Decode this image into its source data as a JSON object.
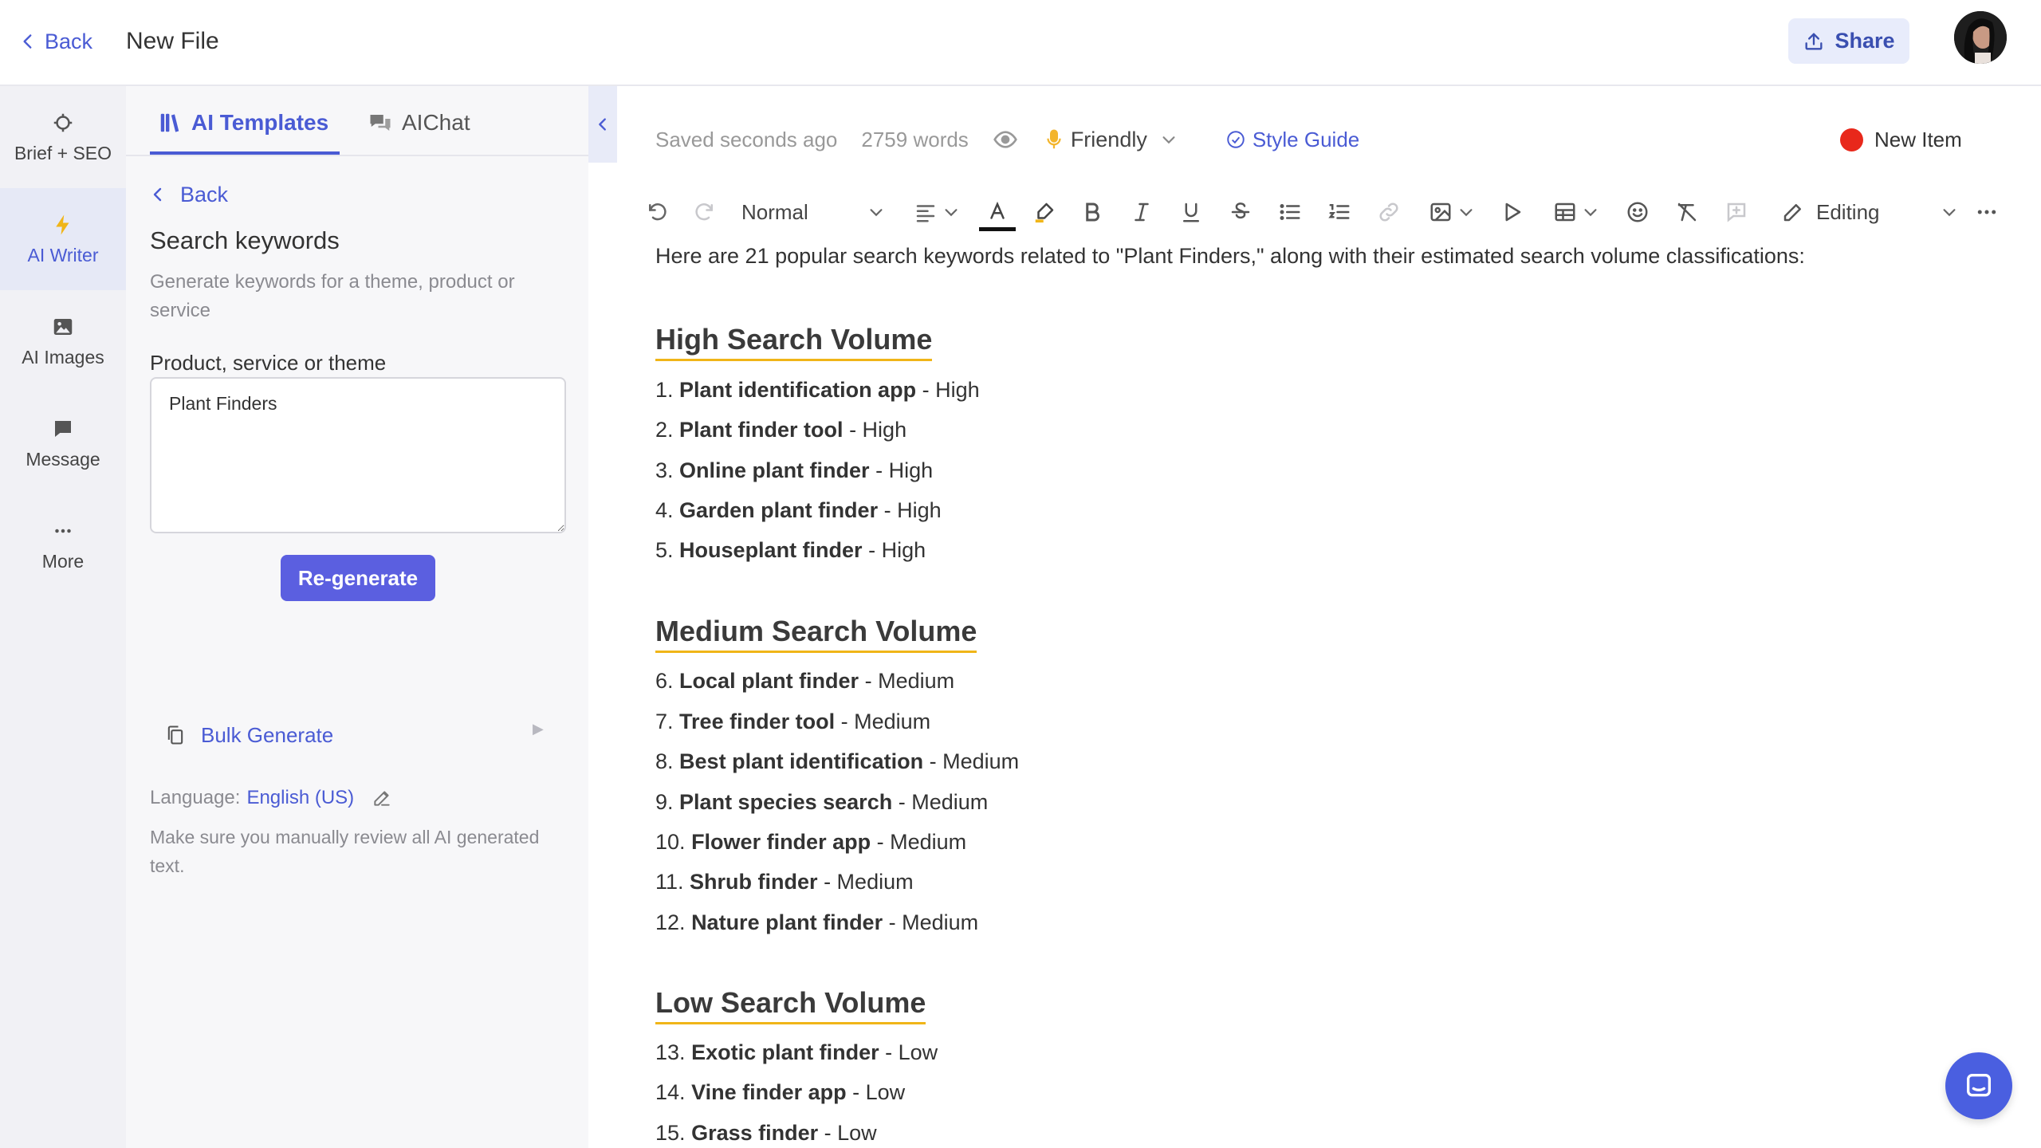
{
  "header": {
    "back_label": "Back",
    "title": "New File",
    "share_label": "Share"
  },
  "rail": {
    "items": [
      {
        "label": "Brief + SEO",
        "icon": "target-icon"
      },
      {
        "label": "AI Writer",
        "icon": "lightning-icon"
      },
      {
        "label": "AI Images",
        "icon": "image-icon"
      },
      {
        "label": "Message",
        "icon": "chat-bubble-icon"
      },
      {
        "label": "More",
        "icon": "more-dots-icon"
      }
    ],
    "active": "AI Writer"
  },
  "panel": {
    "tabs": [
      {
        "label": "AI Templates",
        "icon": "books-icon"
      },
      {
        "label": "AIChat",
        "icon": "chat-bubbles-icon"
      }
    ],
    "back_label": "Back",
    "heading": "Search keywords",
    "description": "Generate keywords for a theme, product or service",
    "field_label": "Product, service or theme",
    "field_value": "Plant Finders",
    "regenerate_label": "Re-generate",
    "bulk_label": "Bulk Generate",
    "language_label": "Language:",
    "language_value": "English (US)",
    "note": "Make sure you manually review all AI generated text."
  },
  "editor": {
    "saved_status": "Saved seconds ago",
    "word_count": "2759 words",
    "tone": "Friendly",
    "style_guide": "Style Guide",
    "new_item": "New Item",
    "style_select": "Normal",
    "mode": "Editing",
    "accent_color": "#4a5bd4",
    "highlight_color": "#f0b518"
  },
  "document": {
    "intro": "Here are 21 popular search keywords related to \"Plant Finders,\" along with their estimated search volume classifications:",
    "sections": [
      {
        "heading": "High Search Volume",
        "items": [
          {
            "num": "1.",
            "term": "Plant identification app",
            "level": "- High"
          },
          {
            "num": "2.",
            "term": "Plant finder tool",
            "level": "- High"
          },
          {
            "num": "3.",
            "term": "Online plant finder",
            "level": "- High"
          },
          {
            "num": "4.",
            "term": "Garden plant finder",
            "level": "- High"
          },
          {
            "num": "5.",
            "term": "Houseplant finder",
            "level": "- High"
          }
        ]
      },
      {
        "heading": "Medium Search Volume",
        "items": [
          {
            "num": "6.",
            "term": "Local plant finder",
            "level": "- Medium"
          },
          {
            "num": "7.",
            "term": "Tree finder tool",
            "level": "- Medium"
          },
          {
            "num": "8.",
            "term": "Best plant identification",
            "level": "- Medium"
          },
          {
            "num": "9.",
            "term": "Plant species search",
            "level": "- Medium"
          },
          {
            "num": "10.",
            "term": "Flower finder app",
            "level": "- Medium"
          },
          {
            "num": "11.",
            "term": "Shrub finder",
            "level": "- Medium"
          },
          {
            "num": "12.",
            "term": "Nature plant finder",
            "level": "- Medium"
          }
        ]
      },
      {
        "heading": "Low Search Volume",
        "items": [
          {
            "num": "13.",
            "term": "Exotic plant finder",
            "level": "- Low"
          },
          {
            "num": "14.",
            "term": "Vine finder app",
            "level": "- Low"
          },
          {
            "num": "15.",
            "term": "Grass finder",
            "level": "- Low"
          }
        ]
      }
    ]
  }
}
